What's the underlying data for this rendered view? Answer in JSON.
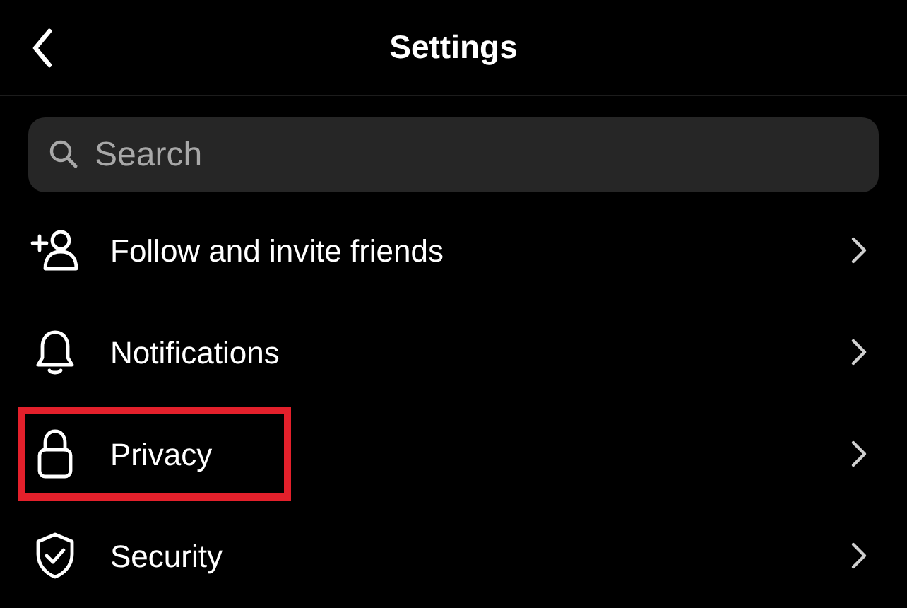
{
  "header": {
    "title": "Settings"
  },
  "search": {
    "placeholder": "Search"
  },
  "items": [
    {
      "kind": "add-person",
      "label": "Follow and invite friends",
      "highlighted": false
    },
    {
      "kind": "bell",
      "label": "Notifications",
      "highlighted": false
    },
    {
      "kind": "lock",
      "label": "Privacy",
      "highlighted": true
    },
    {
      "kind": "shield",
      "label": "Security",
      "highlighted": false
    }
  ]
}
